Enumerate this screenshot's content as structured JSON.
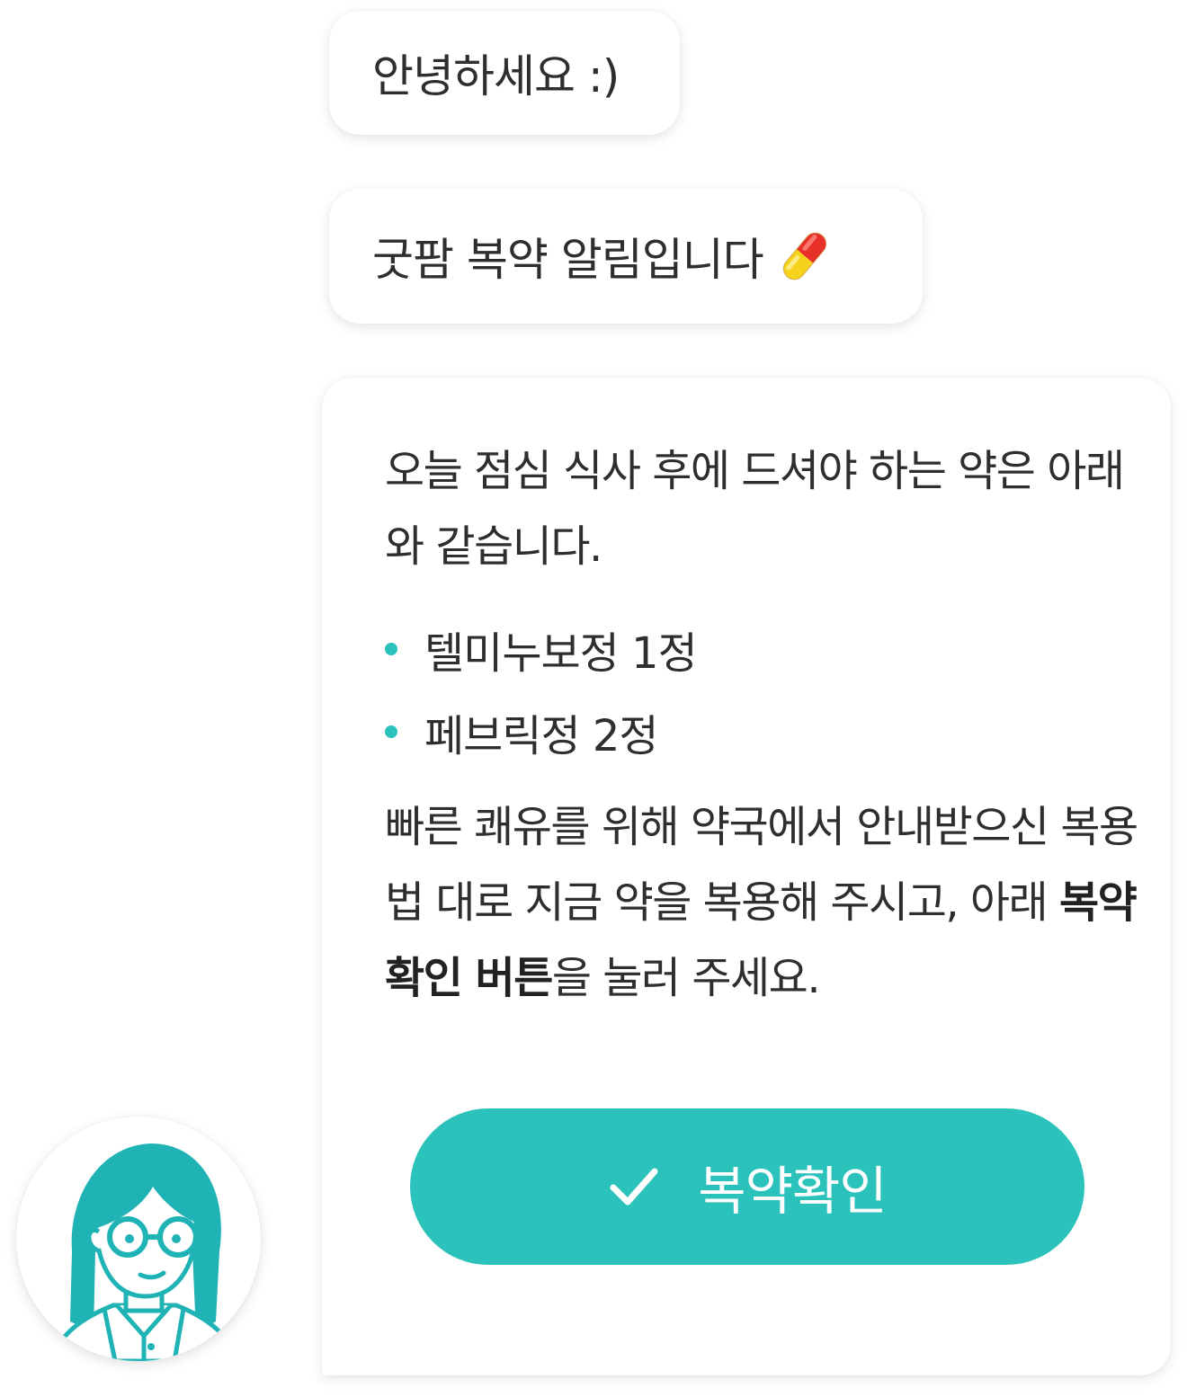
{
  "chat": {
    "greeting": "안녕하세요 :)",
    "notice": "굿팜 복약 알림입니다",
    "notice_icon": "pill-capsule-icon",
    "main_message": {
      "intro": "오늘 점심 식사 후에 드셔야 하는 약은 아래와 같습니다.",
      "medications": [
        {
          "label": "텔미누보정 1정"
        },
        {
          "label": "페브릭정 2정"
        }
      ],
      "outro_part1": "빠른 쾌유를 위해 약국에서 안내받으신 복용법 대로 지금 약을 복용해 주시고, 아래 ",
      "outro_emphasis": "복약 확인 버튼",
      "outro_part2": "을 눌러 주세요."
    },
    "confirm_button": {
      "label": "복약확인",
      "icon": "check-icon"
    },
    "avatar": {
      "icon": "pharmacist-avatar-icon"
    }
  },
  "colors": {
    "accent": "#2cc2bc",
    "text": "#2e2e2e",
    "bubble": "#ffffff",
    "pill_red": "#e8302b",
    "pill_yellow": "#f5d21c"
  }
}
